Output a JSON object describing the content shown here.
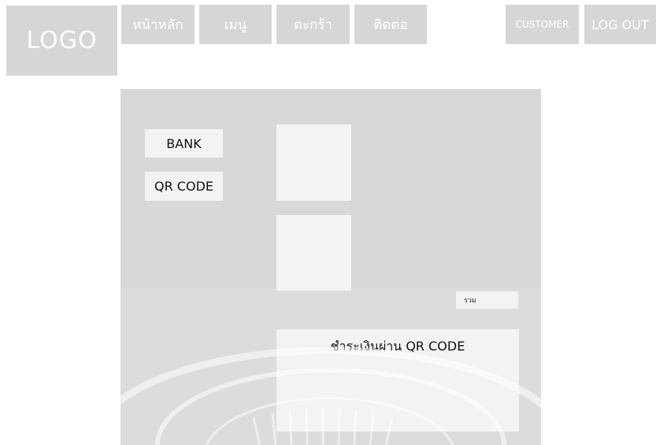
{
  "header": {
    "logo": "LOGO",
    "nav": {
      "home": "หน้าหลัก",
      "menu": "เมนู",
      "cart": "ตะกร้า",
      "contact": "ติดต่อ"
    },
    "customer": "CUSTOMER",
    "logout": "LOG OUT"
  },
  "payment": {
    "methods": {
      "bank": "BANK",
      "qr": "QR CODE"
    },
    "total_label": "รวม",
    "qr_title": "ชำระเงินผ่าน QR CODE"
  },
  "colors": {
    "placeholder_gray": "#d6d6d6",
    "card_light": "#f3f3f3"
  }
}
